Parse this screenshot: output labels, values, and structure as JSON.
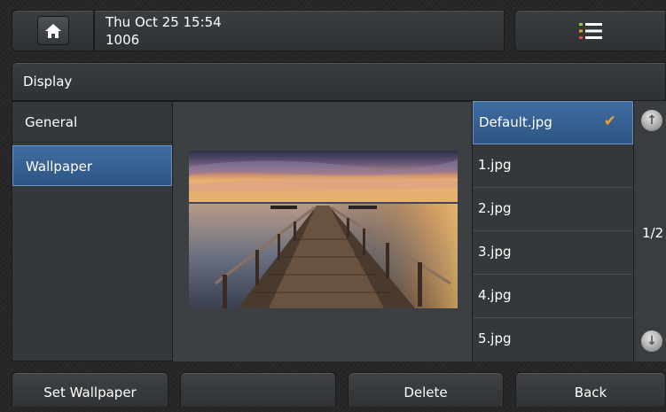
{
  "status": {
    "datetime": "Thu Oct 25 15:54",
    "extension": "1006"
  },
  "title": "Display",
  "sidebar": {
    "items": [
      {
        "label": "General"
      },
      {
        "label": "Wallpaper"
      }
    ]
  },
  "files": {
    "items": [
      {
        "label": "Default.jpg"
      },
      {
        "label": "1.jpg"
      },
      {
        "label": "2.jpg"
      },
      {
        "label": "3.jpg"
      },
      {
        "label": "4.jpg"
      },
      {
        "label": "5.jpg"
      }
    ],
    "selected_index": 0
  },
  "pager": {
    "text": "1/2"
  },
  "softkeys": {
    "set_wallpaper": "Set Wallpaper",
    "blank": "",
    "delete": "Delete",
    "back": "Back"
  },
  "icons": {
    "home": "home-icon",
    "menu": "menu-list-icon",
    "check": "checkmark-icon",
    "up": "scroll-up-icon",
    "down": "scroll-down-icon"
  },
  "colors": {
    "selected": "#3a6396",
    "check": "#f0a030"
  }
}
